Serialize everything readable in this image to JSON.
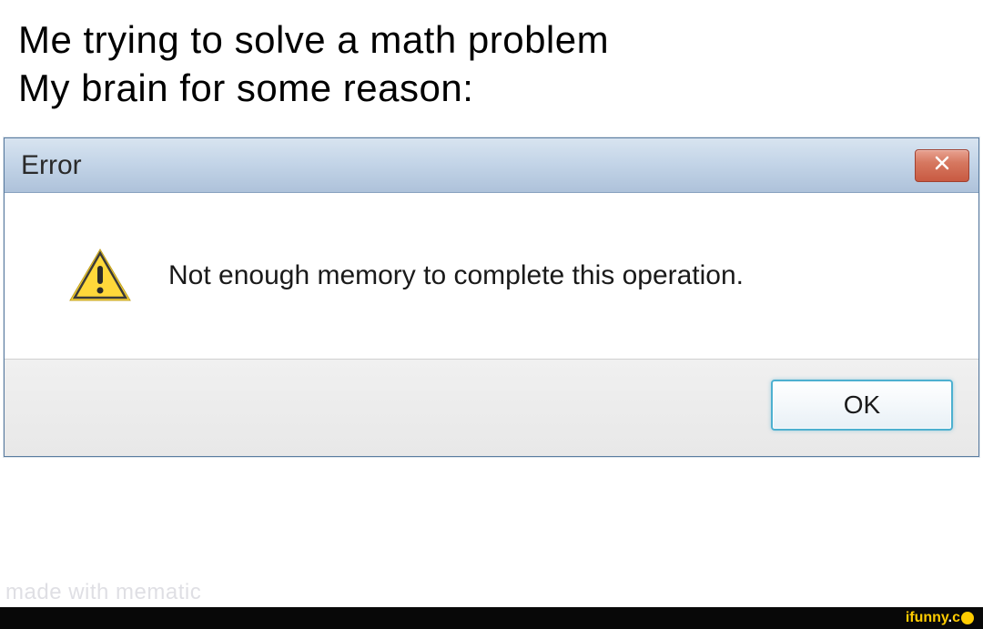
{
  "caption": {
    "line1": "Me trying to solve a math problem",
    "line2": "My brain for some reason:"
  },
  "dialog": {
    "title": "Error",
    "message": "Not enough memory to complete this operation.",
    "ok_label": "OK"
  },
  "watermark": {
    "mematic": "made with mematic",
    "ifunny": "ifunny.co"
  }
}
